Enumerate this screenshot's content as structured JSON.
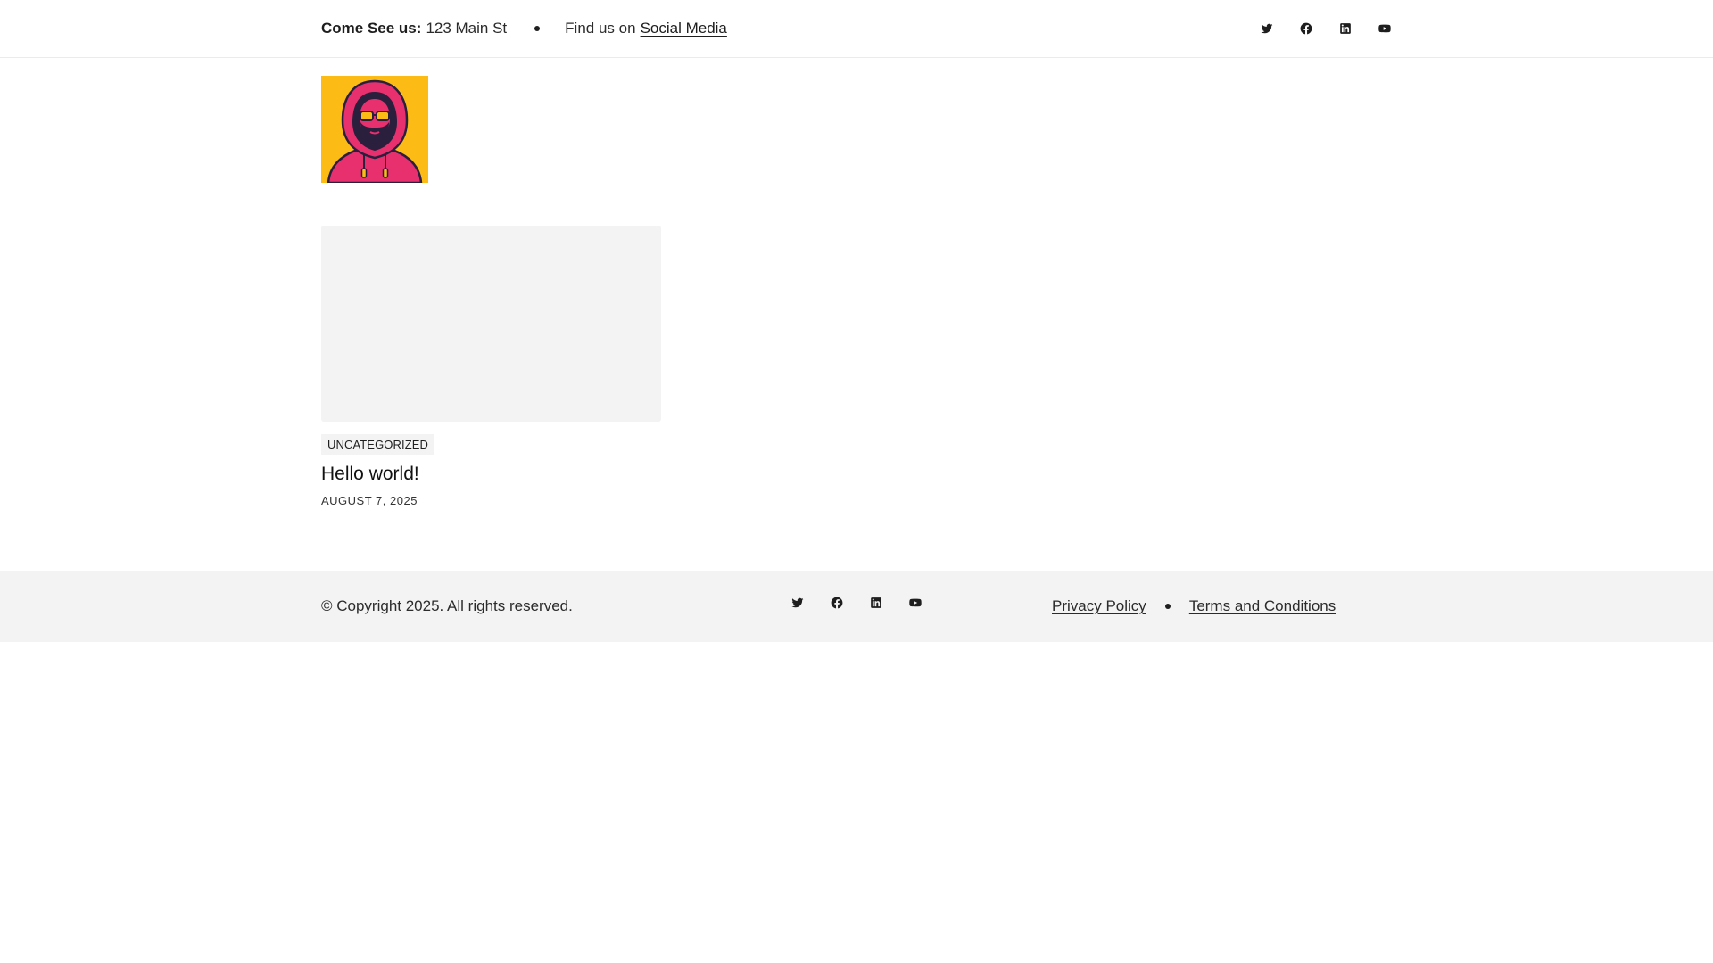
{
  "topbar": {
    "address_label": "Come See us:",
    "address_value": "123 Main St",
    "find_prefix": "Find us on",
    "social_link": "Social Media",
    "social_icons": [
      "twitter-icon",
      "facebook-icon",
      "linkedin-icon",
      "youtube-icon"
    ]
  },
  "logo": {
    "icon": "hooded-avatar-logo",
    "colors": {
      "background": "#fdbb16",
      "hoodie": "#e8306f",
      "outline": "#2a1f3d"
    }
  },
  "post": {
    "category": "UNCATEGORIZED",
    "title": "Hello world!",
    "date": "AUGUST 7, 2025"
  },
  "footer": {
    "copyright": "© Copyright 2025. All rights reserved.",
    "social_icons": [
      "twitter-icon",
      "facebook-icon",
      "linkedin-icon",
      "youtube-icon"
    ],
    "privacy_link": "Privacy Policy",
    "terms_link": "Terms and Conditions"
  },
  "colors": {
    "footer_bg": "#f3f3f3",
    "placeholder_bg": "#f3f3f3",
    "text": "#1e1e1e"
  }
}
